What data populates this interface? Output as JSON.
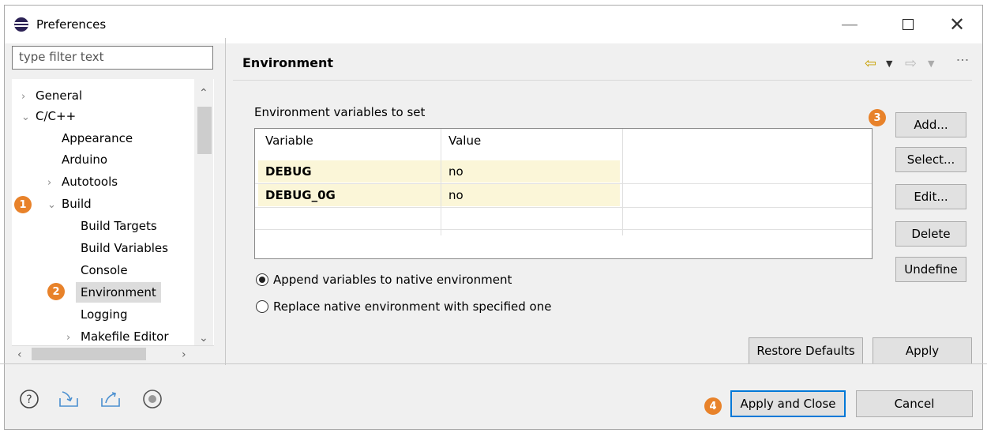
{
  "window": {
    "title": "Preferences"
  },
  "filter": {
    "placeholder": "type filter text"
  },
  "tree": {
    "items": [
      {
        "label": "General",
        "expander": ">"
      },
      {
        "label": "C/C++",
        "expander": "v"
      },
      {
        "label": "Appearance"
      },
      {
        "label": "Arduino"
      },
      {
        "label": "Autotools",
        "expander": ">"
      },
      {
        "label": "Build",
        "expander": "v"
      },
      {
        "label": "Build Targets"
      },
      {
        "label": "Build Variables"
      },
      {
        "label": "Console"
      },
      {
        "label": "Environment",
        "selected": true
      },
      {
        "label": "Logging"
      },
      {
        "label": "Makefile Editor",
        "expander": ">"
      }
    ]
  },
  "page": {
    "title": "Environment"
  },
  "env": {
    "group_label": "Environment variables to set",
    "columns": [
      "Variable",
      "Value"
    ],
    "rows": [
      {
        "variable": "DEBUG",
        "value": "no"
      },
      {
        "variable": "DEBUG_0G",
        "value": "no"
      }
    ],
    "append_label": "Append variables to native environment",
    "replace_label": "Replace native environment with specified one",
    "append_selected": true
  },
  "side_buttons": [
    "Add...",
    "Select...",
    "Edit...",
    "Delete",
    "Undefine"
  ],
  "buttons": {
    "restore_defaults": "Restore Defaults",
    "apply": "Apply",
    "apply_and_close": "Apply and Close",
    "cancel": "Cancel"
  },
  "badges": [
    "1",
    "2",
    "3",
    "4"
  ],
  "colors": {
    "badge": "#e8822a",
    "highlight_row": "#fbf6d8",
    "default_button_border": "#0078d7"
  }
}
